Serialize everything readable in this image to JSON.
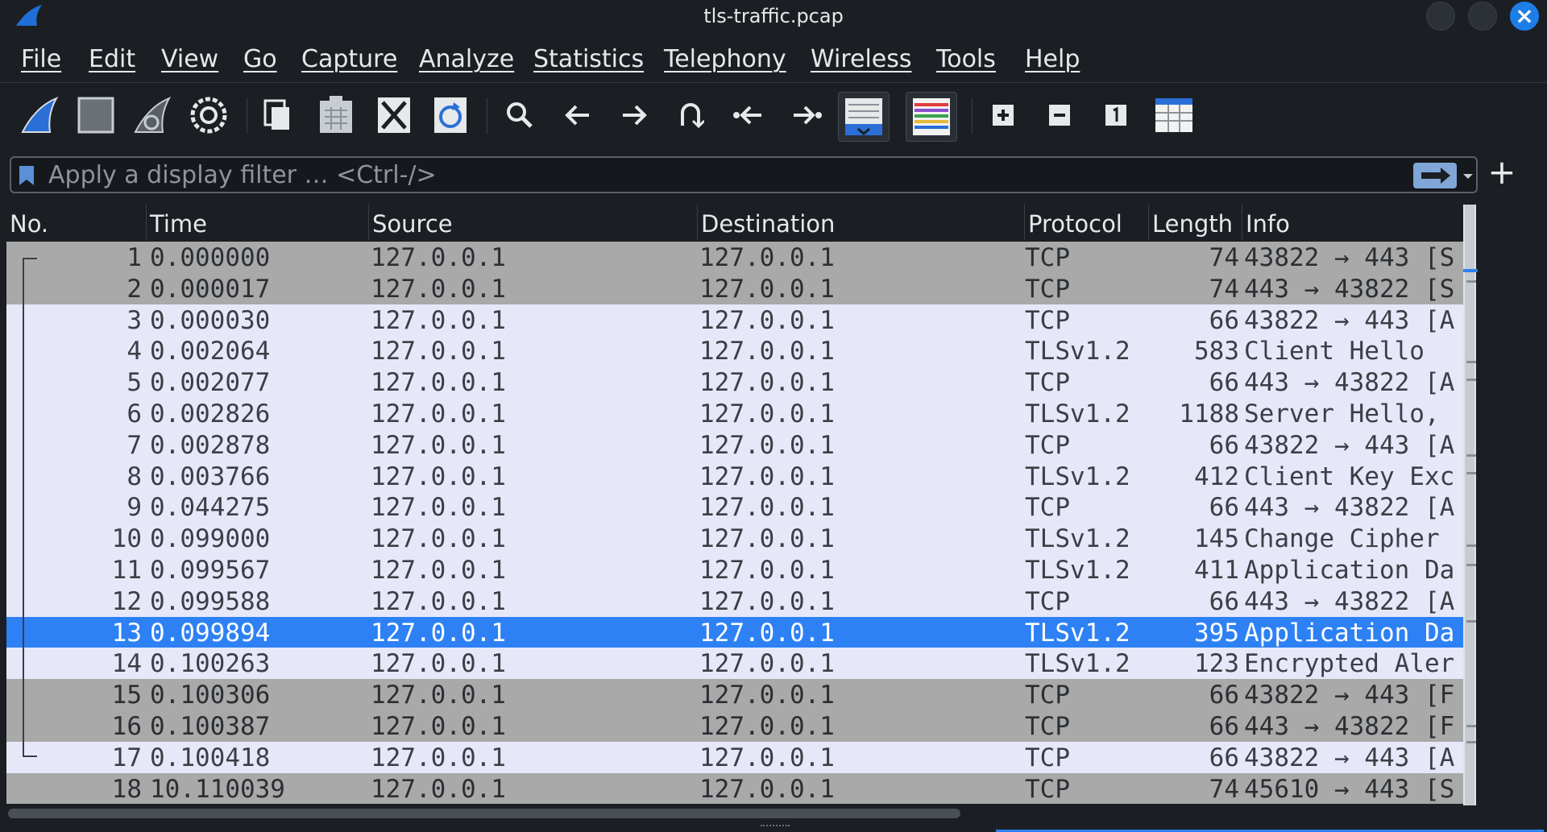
{
  "window": {
    "title": "tls-traffic.pcap",
    "app_icon": "wireshark-fin-icon"
  },
  "menu": [
    "File",
    "Edit",
    "View",
    "Go",
    "Capture",
    "Analyze",
    "Statistics",
    "Telephony",
    "Wireless",
    "Tools",
    "Help"
  ],
  "toolbar": {
    "icons": [
      "start-capture-icon",
      "stop-capture-icon",
      "restart-capture-icon",
      "capture-options-icon",
      "open-file-icon",
      "save-file-icon",
      "close-file-icon",
      "reload-file-icon",
      "find-packet-icon",
      "go-back-icon",
      "go-forward-icon",
      "go-to-packet-icon",
      "first-packet-icon",
      "last-packet-icon",
      "auto-scroll-icon",
      "colorize-icon",
      "zoom-in-icon",
      "zoom-out-icon",
      "normal-size-icon",
      "resize-columns-icon"
    ]
  },
  "filter": {
    "placeholder": "Apply a display filter … <Ctrl-/>",
    "value": ""
  },
  "columns": [
    "No.",
    "Time",
    "Source",
    "Destination",
    "Protocol",
    "Length",
    "Info"
  ],
  "packets": [
    {
      "no": "1",
      "time": "0.000000",
      "src": "127.0.0.1",
      "dst": "127.0.0.1",
      "proto": "TCP",
      "len": "74",
      "info": "43822 → 443 [S",
      "style": "gray"
    },
    {
      "no": "2",
      "time": "0.000017",
      "src": "127.0.0.1",
      "dst": "127.0.0.1",
      "proto": "TCP",
      "len": "74",
      "info": "443 → 43822 [S",
      "style": "gray"
    },
    {
      "no": "3",
      "time": "0.000030",
      "src": "127.0.0.1",
      "dst": "127.0.0.1",
      "proto": "TCP",
      "len": "66",
      "info": "43822 → 443 [A",
      "style": "lavender"
    },
    {
      "no": "4",
      "time": "0.002064",
      "src": "127.0.0.1",
      "dst": "127.0.0.1",
      "proto": "TLSv1.2",
      "len": "583",
      "info": "Client Hello",
      "style": "lavender"
    },
    {
      "no": "5",
      "time": "0.002077",
      "src": "127.0.0.1",
      "dst": "127.0.0.1",
      "proto": "TCP",
      "len": "66",
      "info": "443 → 43822 [A",
      "style": "lavender"
    },
    {
      "no": "6",
      "time": "0.002826",
      "src": "127.0.0.1",
      "dst": "127.0.0.1",
      "proto": "TLSv1.2",
      "len": "1188",
      "info": "Server Hello,",
      "style": "lavender"
    },
    {
      "no": "7",
      "time": "0.002878",
      "src": "127.0.0.1",
      "dst": "127.0.0.1",
      "proto": "TCP",
      "len": "66",
      "info": "43822 → 443 [A",
      "style": "lavender"
    },
    {
      "no": "8",
      "time": "0.003766",
      "src": "127.0.0.1",
      "dst": "127.0.0.1",
      "proto": "TLSv1.2",
      "len": "412",
      "info": "Client Key Exc",
      "style": "lavender"
    },
    {
      "no": "9",
      "time": "0.044275",
      "src": "127.0.0.1",
      "dst": "127.0.0.1",
      "proto": "TCP",
      "len": "66",
      "info": "443 → 43822 [A",
      "style": "lavender"
    },
    {
      "no": "10",
      "time": "0.099000",
      "src": "127.0.0.1",
      "dst": "127.0.0.1",
      "proto": "TLSv1.2",
      "len": "145",
      "info": "Change Cipher",
      "style": "lavender"
    },
    {
      "no": "11",
      "time": "0.099567",
      "src": "127.0.0.1",
      "dst": "127.0.0.1",
      "proto": "TLSv1.2",
      "len": "411",
      "info": "Application Da",
      "style": "lavender"
    },
    {
      "no": "12",
      "time": "0.099588",
      "src": "127.0.0.1",
      "dst": "127.0.0.1",
      "proto": "TCP",
      "len": "66",
      "info": "443 → 43822 [A",
      "style": "lavender"
    },
    {
      "no": "13",
      "time": "0.099894",
      "src": "127.0.0.1",
      "dst": "127.0.0.1",
      "proto": "TLSv1.2",
      "len": "395",
      "info": "Application Da",
      "style": "selected"
    },
    {
      "no": "14",
      "time": "0.100263",
      "src": "127.0.0.1",
      "dst": "127.0.0.1",
      "proto": "TLSv1.2",
      "len": "123",
      "info": "Encrypted Aler",
      "style": "lavender"
    },
    {
      "no": "15",
      "time": "0.100306",
      "src": "127.0.0.1",
      "dst": "127.0.0.1",
      "proto": "TCP",
      "len": "66",
      "info": "43822 → 443 [F",
      "style": "gray"
    },
    {
      "no": "16",
      "time": "0.100387",
      "src": "127.0.0.1",
      "dst": "127.0.0.1",
      "proto": "TCP",
      "len": "66",
      "info": "443 → 43822 [F",
      "style": "gray"
    },
    {
      "no": "17",
      "time": "0.100418",
      "src": "127.0.0.1",
      "dst": "127.0.0.1",
      "proto": "TCP",
      "len": "66",
      "info": "43822 → 443 [A",
      "style": "lavender"
    },
    {
      "no": "18",
      "time": "10.110039",
      "src": "127.0.0.1",
      "dst": "127.0.0.1",
      "proto": "TCP",
      "len": "74",
      "info": "45610 → 443 [S",
      "style": "gray"
    }
  ],
  "colors": {
    "background": "#1b1f24",
    "row_gray": "#a9a9a9",
    "row_lavender": "#e6e8fa",
    "row_selected": "#2d81f4",
    "accent": "#1e7ee8"
  }
}
